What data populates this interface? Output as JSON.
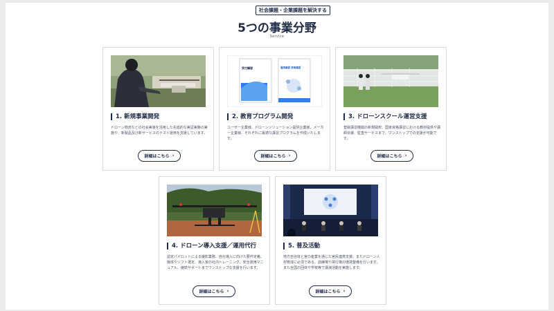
{
  "section": {
    "eyebrow": "社会課題・企業課題を解決する",
    "title": "5つの事業分野",
    "subtitle": "Service"
  },
  "cards": [
    {
      "title": "1. 新規事業開発",
      "description": "ドローン物流などの社会実装を活用した先進的な実証実験の実施や、新製品及び新サービスのテスト運用を支援しています。",
      "button": "詳細はこちら",
      "image_icon": "drone-operator-photo"
    },
    {
      "title": "2. 教育プログラム開発",
      "description": "ユーザー企業様、ドローンソリューション提供企業様、メーカー企業様、それぞれに最適な講習プログラムを作成いたします。",
      "button": "詳細はこちら",
      "image_icon": "textbook-photo",
      "book_left": "受付講習",
      "book_right": "運用講習 技術講習"
    },
    {
      "title": "3. ドローンスクール運営支援",
      "description": "登録講習機関の新規開校、国家資格講習における教材提供や講師派遣、監査サービスまで、ワンストップでの支援が可能です。",
      "button": "詳細はこちら",
      "image_icon": "drone-school-photo"
    },
    {
      "title": "4. ドローン導入支援／運用代行",
      "description": "認定パイロットによる撮影業務、自社導入に向けた要件定義、機体やソフト選定、導入後の社内トレーニング、安全運用マニュアル、継続サポートまでワンストップな支援を行います。",
      "button": "詳細はこちら",
      "image_icon": "industrial-drone-photo"
    },
    {
      "title": "5. 普及活動",
      "description": "地方自治体と官の産業を通じた官民連携支援。またドローン人材育成に必須である、訓練場や飛行場の環境整備を行います。また全国の団体や学校等で講演活動を実施します。",
      "button": "詳細はこちら",
      "image_icon": "seminar-photo"
    }
  ],
  "colors": {
    "navy": "#1f2a44",
    "background": "#eceaed",
    "card_border": "#d9d9de"
  }
}
